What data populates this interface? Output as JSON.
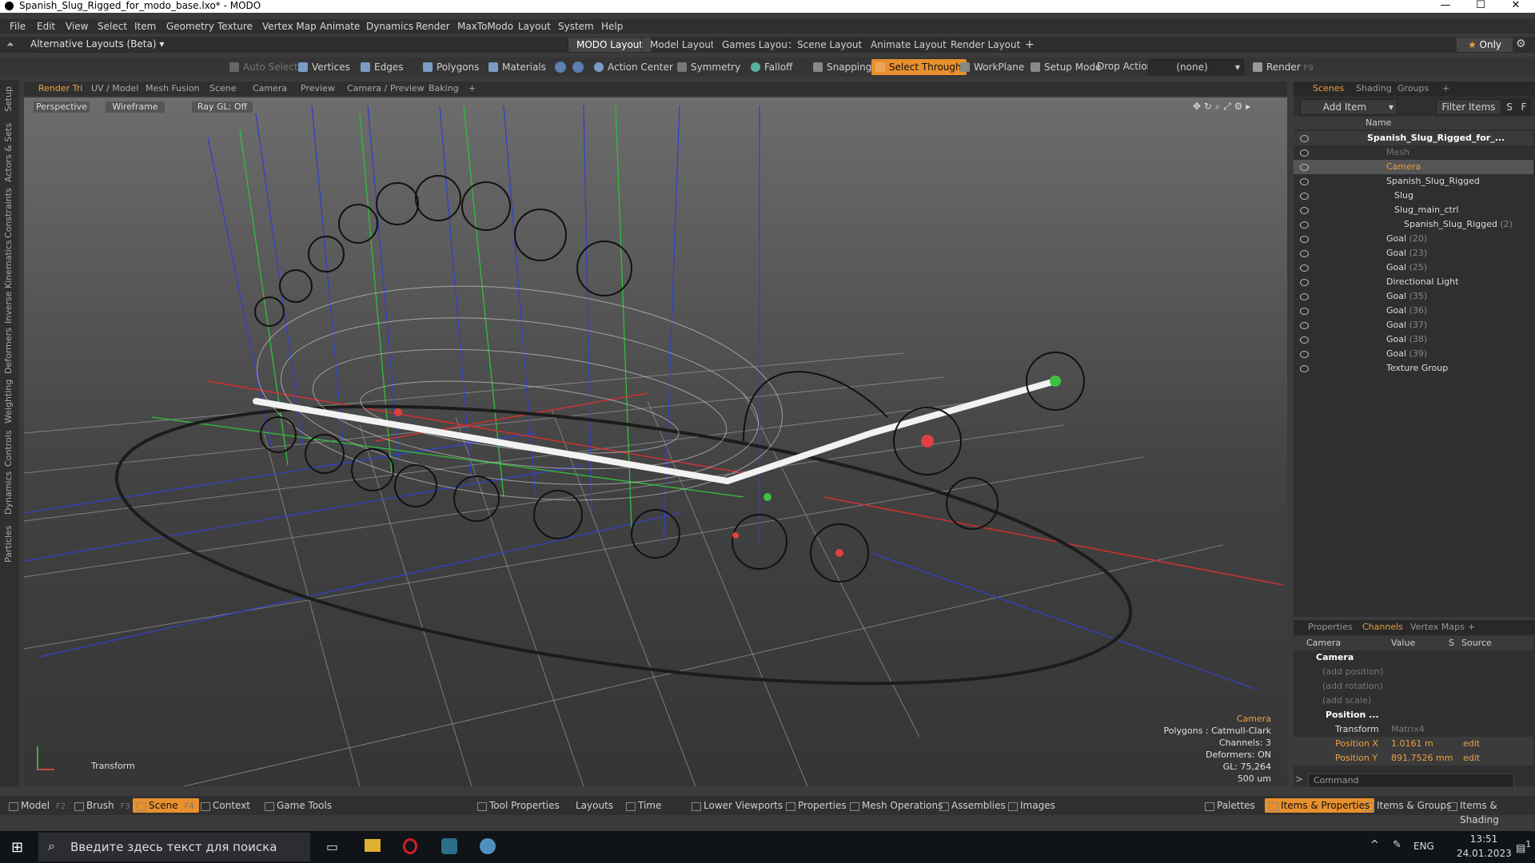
{
  "window": {
    "title": "Spanish_Slug_Rigged_for_modo_base.lxo* - MODO",
    "minimize": "—",
    "maximize": "☐",
    "close": "✕"
  },
  "menu": [
    "File",
    "Edit",
    "View",
    "Select",
    "Item",
    "Geometry",
    "Texture",
    "Vertex Map",
    "Animate",
    "Dynamics",
    "Render",
    "MaxToModo",
    "Layout",
    "System",
    "Help"
  ],
  "layout_bar": {
    "layout_dropdown": "Alternative Layouts (Beta)",
    "tabs": [
      "MODO Layout",
      "Model Layout",
      "Games Layout",
      "Scene Layout",
      "Animate Layout",
      "Render Layout"
    ],
    "active_tab": "MODO Layout",
    "add": "+",
    "only": "Only"
  },
  "toolbar": {
    "auto_select": "Auto Select",
    "vertices": "Vertices",
    "edges": "Edges",
    "polygons": "Polygons",
    "materials": "Materials",
    "action_center": "Action Center",
    "symmetry": "Symmetry",
    "falloff": "Falloff",
    "snapping": "Snapping",
    "select_through": "Select Through",
    "workplane": "WorkPlane",
    "setup_mode": "Setup Mode",
    "drop_action": "Drop Action",
    "drop_action_value": "(none)",
    "render": "Render",
    "render_key": "F9"
  },
  "left_strip": [
    "Setup",
    "Actors & Sets",
    "Constraints",
    "Inverse Kinematics",
    "Deformers",
    "Weighting",
    "Controls",
    "Dynamics",
    "Particles"
  ],
  "viewport_tabs": [
    "Render Tri",
    "UV / Model",
    "Mesh Fusion",
    "Scene",
    "Camera",
    "Preview",
    "Camera / Preview",
    "Baking",
    "+"
  ],
  "viewport": {
    "view_mode": "Perspective",
    "shading": "Wireframe",
    "raygl": "Ray GL: Off",
    "tool_label": "Transform",
    "info": {
      "item": "Camera",
      "polygons": "Polygons : Catmull-Clark",
      "channels": "Channels: 3",
      "deformers": "Deformers: ON",
      "gl": "GL: 75,264",
      "scale": "500 um"
    }
  },
  "scene_panel": {
    "tabs": [
      "Scenes",
      "Shading",
      "Groups",
      "+"
    ],
    "add_item": "Add Item",
    "filter_items": "Filter Items",
    "s": "S",
    "f": "F",
    "col_name": "Name",
    "items": [
      {
        "label": "Spanish_Slug_Rigged_for_...",
        "num": ""
      },
      {
        "label": "Mesh",
        "num": ""
      },
      {
        "label": "Camera",
        "num": ""
      },
      {
        "label": "Spanish_Slug_Rigged",
        "num": ""
      },
      {
        "label": "Slug",
        "num": ""
      },
      {
        "label": "Slug_main_ctrl",
        "num": ""
      },
      {
        "label": "Spanish_Slug_Rigged",
        "num": "(2)"
      },
      {
        "label": "Goal",
        "num": "(20)"
      },
      {
        "label": "Goal",
        "num": "(23)"
      },
      {
        "label": "Goal",
        "num": "(25)"
      },
      {
        "label": "Directional Light",
        "num": ""
      },
      {
        "label": "Goal",
        "num": "(35)"
      },
      {
        "label": "Goal",
        "num": "(36)"
      },
      {
        "label": "Goal",
        "num": "(37)"
      },
      {
        "label": "Goal",
        "num": "(38)"
      },
      {
        "label": "Goal",
        "num": "(39)"
      },
      {
        "label": "Texture Group",
        "num": ""
      }
    ]
  },
  "channels_panel": {
    "tabs": [
      "Properties",
      "Channels",
      "Vertex Maps",
      "+"
    ],
    "cols": {
      "name": "Camera",
      "value": "Value",
      "s": "S",
      "source": "Source"
    },
    "item": "Camera",
    "add_position": "(add position)",
    "add_rotation": "(add rotation)",
    "add_scale": "(add scale)",
    "position_group": "Position ...",
    "transform": {
      "name": "Transform",
      "value": "Matrix4"
    },
    "pos_x": {
      "name": "Position X",
      "value": "1.0161 m",
      "source": "edit"
    },
    "pos_y": {
      "name": "Position Y",
      "value": "891.7526 mm",
      "source": "edit"
    }
  },
  "command": {
    "placeholder": "Command",
    "prompt": ">"
  },
  "bottom_bar": {
    "model": "Model",
    "model_key": "F2",
    "brush": "Brush",
    "brush_key": "F3",
    "scene": "Scene",
    "scene_key": "F4",
    "context": "Context",
    "game_tools": "Game Tools",
    "tool_properties": "Tool Properties",
    "layouts": "Layouts",
    "time": "Time",
    "lower_viewports": "Lower Viewports",
    "properties": "Properties",
    "mesh_operations": "Mesh Operations",
    "assemblies": "Assemblies",
    "images": "Images",
    "palettes": "Palettes",
    "items_properties": "Items & Properties",
    "items_groups": "Items & Groups",
    "items_shading": "Items & Shading"
  },
  "taskbar": {
    "search_placeholder": "Введите здесь текст для поиска",
    "lang": "ENG",
    "time": "13:51",
    "date": "24.01.2023",
    "notif": "1"
  },
  "colors": {
    "accent": "#e8902d",
    "panel": "#2f2f2f",
    "viewport_top": "#6d6d6d",
    "viewport_bottom": "#353535"
  }
}
